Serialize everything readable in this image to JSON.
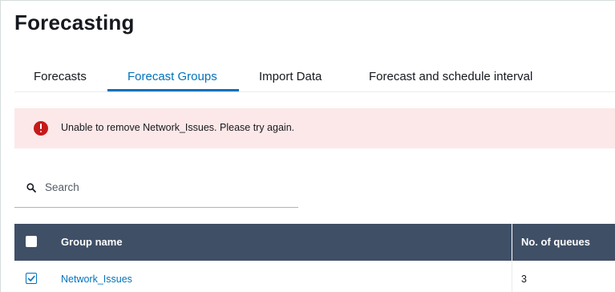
{
  "page": {
    "title": "Forecasting"
  },
  "tabs": [
    {
      "label": "Forecasts",
      "active": false
    },
    {
      "label": "Forecast Groups",
      "active": true
    },
    {
      "label": "Import Data",
      "active": false
    },
    {
      "label": "Forecast and schedule interval",
      "active": false
    }
  ],
  "alert": {
    "type": "error",
    "message": "Unable to remove Network_Issues. Please try again.",
    "icon": "error-icon",
    "color": "#c51a1a"
  },
  "search": {
    "placeholder": "Search",
    "value": "",
    "icon": "search-icon"
  },
  "table": {
    "columns": [
      "Group name",
      "No. of queues"
    ],
    "rows": [
      {
        "group_name": "Network_Issues",
        "queues": "3",
        "checked": true
      }
    ]
  },
  "colors": {
    "accent": "#0073bb",
    "header_bg": "#3f4f66",
    "alert_bg": "#fce8e8"
  }
}
